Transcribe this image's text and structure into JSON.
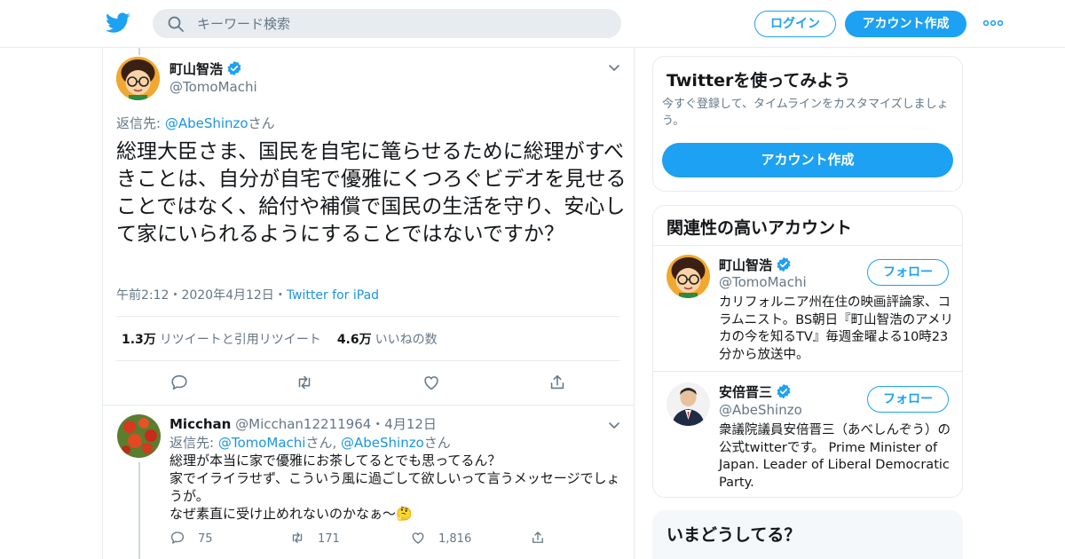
{
  "header": {
    "search_placeholder": "キーワード検索",
    "login_label": "ログイン",
    "signup_label": "アカウント作成",
    "brand_color": "#1da1f2"
  },
  "tweet": {
    "author_name": "町山智浩",
    "author_handle": "@TomoMachi",
    "reply_prefix": "返信先: ",
    "reply_to": "@AbeShinzo",
    "reply_suffix": "さん",
    "text": "総理大臣さま、国民を自宅に篭らせるために総理がすべきことは、自分が自宅で優雅にくつろぐビデオを見せることではなく、給付や補償で国民の生活を守り、安心して家にいられるようにすることではないですか？",
    "time": "午前2:12",
    "date": "2020年4月12日",
    "sep": "・",
    "source": "Twitter for iPad",
    "retweets": "1.3万",
    "retweets_label": "リツイートと引用リツイート",
    "likes": "4.6万",
    "likes_label": "いいねの数"
  },
  "reply": {
    "name": "Micchan",
    "handle": "@Micchan12211964",
    "date": "・4月12日",
    "reply_prefix": "返信先: ",
    "reply_to_1": "@TomoMachi",
    "reply_mid": "さん, ",
    "reply_to_2": "@AbeShinzo",
    "reply_suffix": "さん",
    "line1": "総理が本当に家で優雅にお茶してるとでも思ってるん？",
    "line2": "家でイライラせず、こういう風に過ごして欲しいって言うメッセージでしょうが。",
    "line3": "なぜ素直に受け止めれないのかなぁ〜🤔",
    "reply_count": "75",
    "retweet_count": "171",
    "like_count": "1,816"
  },
  "sidebar": {
    "try_title": "Twitterを使ってみよう",
    "try_desc": "今すぐ登録して、タイムラインをカスタマイズしましょう。",
    "try_cta": "アカウント作成",
    "related_title": "関連性の高いアカウント",
    "follow_label": "フォロー",
    "accounts": [
      {
        "name": "町山智浩",
        "handle": "@TomoMachi",
        "bio": "カリフォルニア州在住の映画評論家、コラムニスト。BS朝日『町山智浩のアメリカの今を知るTV』毎週金曜よる10時23分から放送中。"
      },
      {
        "name": "安倍晋三",
        "handle": "@AbeShinzo",
        "bio": "衆議院議員安倍晋三（あべしんぞう）の公式twitterです。 Prime Minister of Japan. Leader of Liberal Democratic Party."
      }
    ],
    "whats_happening": "いまどうしてる？"
  }
}
